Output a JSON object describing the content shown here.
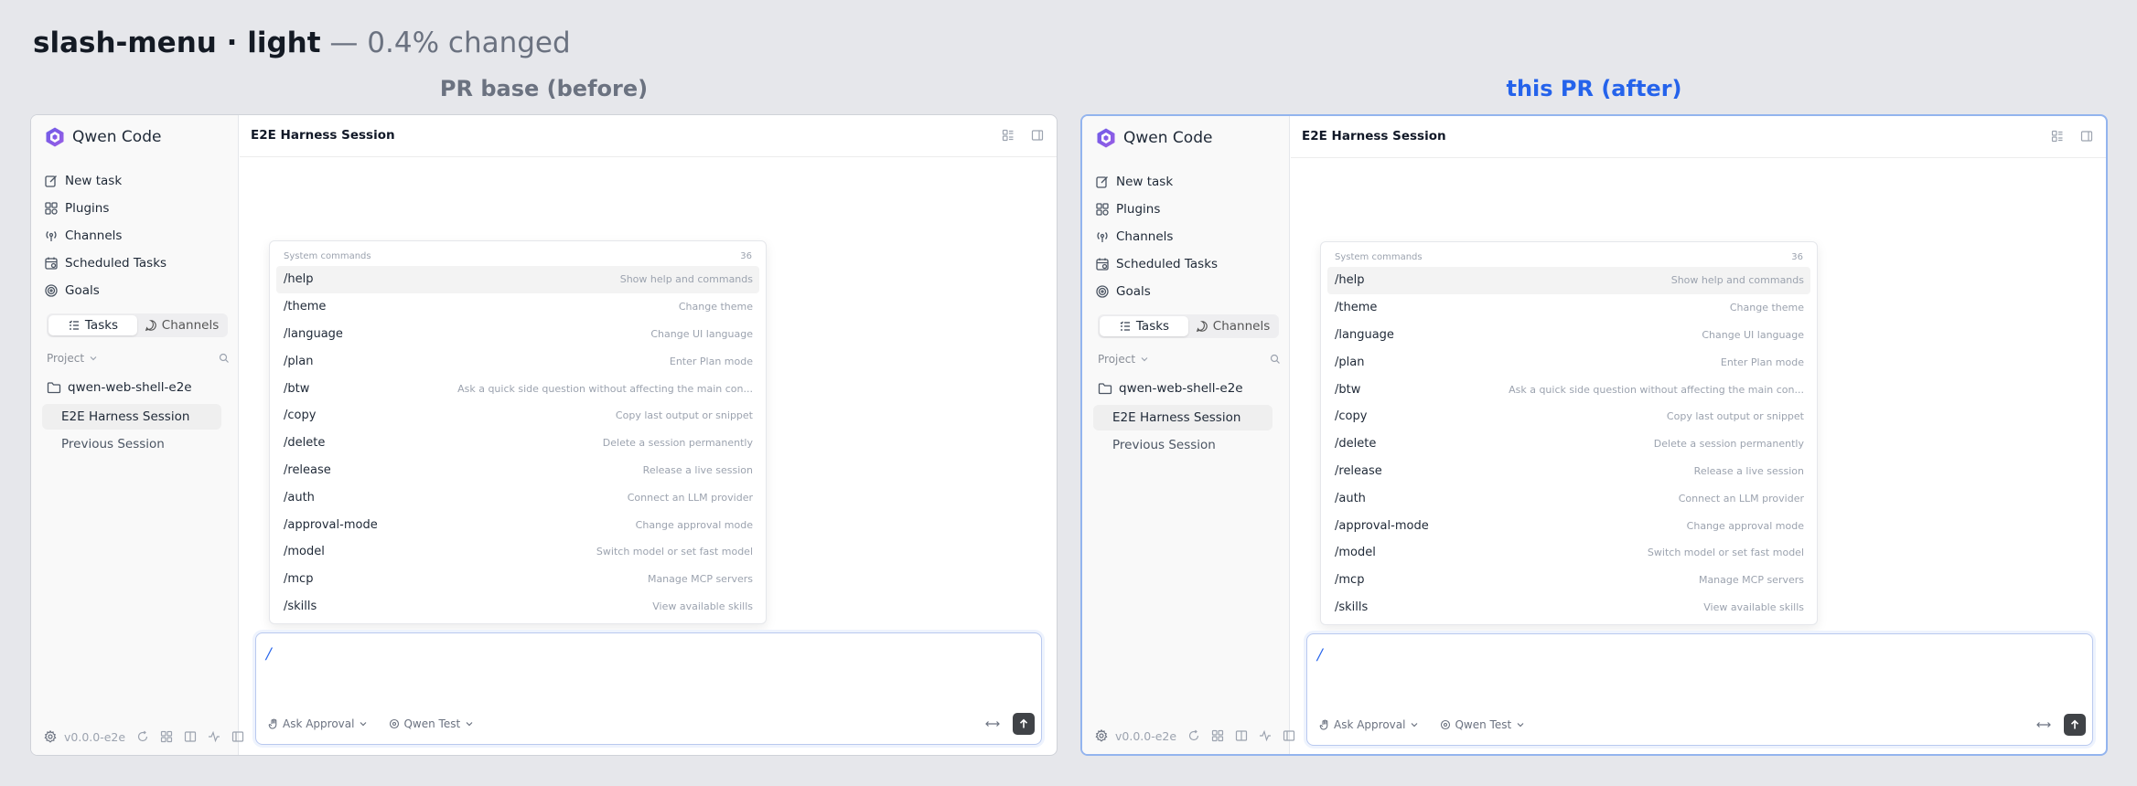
{
  "header": {
    "name": "slash-menu",
    "separator": " · ",
    "theme": "light",
    "change": " — 0.4% changed"
  },
  "columns": {
    "before_label": "PR base (before)",
    "after_label": "this PR (after)"
  },
  "app": {
    "brand": "Qwen Code",
    "nav": [
      {
        "label": "New task",
        "icon": "edit-icon"
      },
      {
        "label": "Plugins",
        "icon": "plugins-icon"
      },
      {
        "label": "Channels",
        "icon": "broadcast-icon"
      },
      {
        "label": "Scheduled Tasks",
        "icon": "calendar-icon"
      },
      {
        "label": "Goals",
        "icon": "target-icon"
      }
    ],
    "segments": {
      "tasks": "Tasks",
      "channels": "Channels"
    },
    "project_label": "Project",
    "folder": "qwen-web-shell-e2e",
    "sessions": [
      "E2E Harness Session",
      "Previous Session"
    ],
    "version": "v0.0.0-e2e",
    "session_title": "E2E Harness Session",
    "menu": {
      "header": "System commands",
      "count": "36",
      "commands": [
        {
          "name": "/help",
          "desc": "Show help and commands"
        },
        {
          "name": "/theme",
          "desc": "Change theme"
        },
        {
          "name": "/language",
          "desc": "Change UI language"
        },
        {
          "name": "/plan",
          "desc": "Enter Plan mode"
        },
        {
          "name": "/btw",
          "desc": "Ask a quick side question without affecting the main con..."
        },
        {
          "name": "/copy",
          "desc": "Copy last output or snippet"
        },
        {
          "name": "/delete",
          "desc": "Delete a session permanently"
        },
        {
          "name": "/release",
          "desc": "Release a live session"
        },
        {
          "name": "/auth",
          "desc": "Connect an LLM provider"
        },
        {
          "name": "/approval-mode",
          "desc": "Change approval mode"
        },
        {
          "name": "/model",
          "desc": "Switch model or set fast model"
        },
        {
          "name": "/mcp",
          "desc": "Manage MCP servers"
        },
        {
          "name": "/skills",
          "desc": "View available skills"
        }
      ]
    },
    "composer": {
      "value": "/",
      "approval": "Ask Approval",
      "model": "Qwen Test"
    }
  }
}
